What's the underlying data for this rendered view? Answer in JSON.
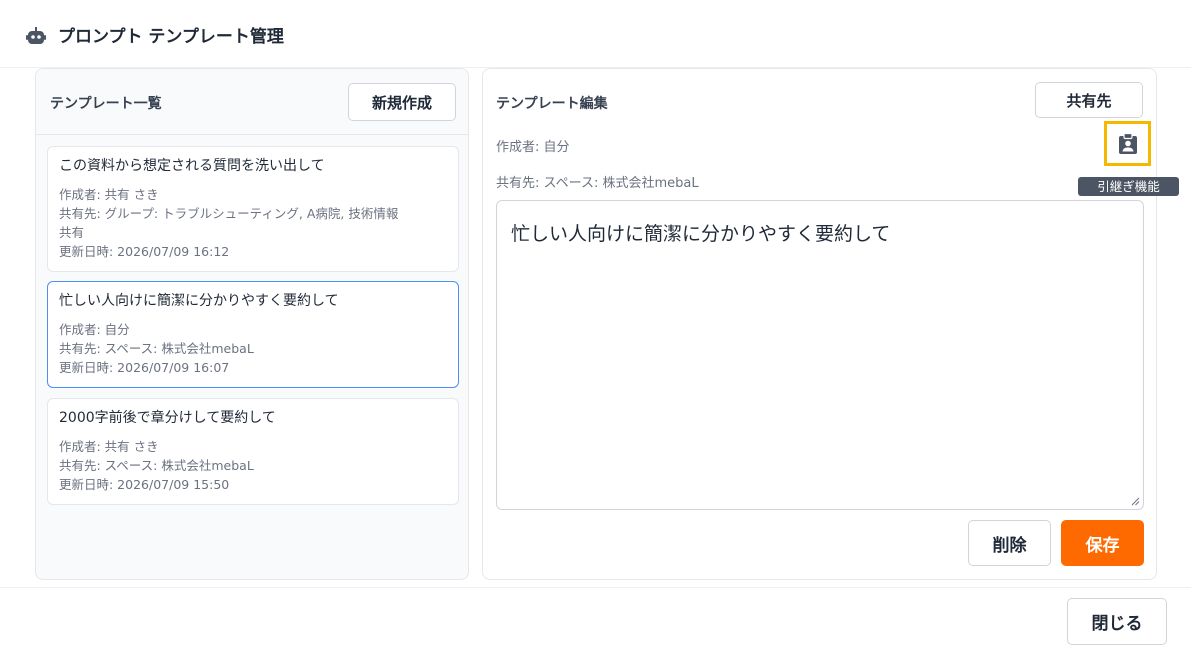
{
  "header": {
    "icon": "robot-icon",
    "title": "プロンプト テンプレート管理"
  },
  "list_panel": {
    "title": "テンプレート一覧",
    "new_button": "新規作成",
    "templates": [
      {
        "title": "この資料から想定される質問を洗い出して",
        "author": "作成者: 共有 さき",
        "share_line1": "共有先: グループ: トラブルシューティング, A病院, 技術情報",
        "share_line2": "共有",
        "updated": "更新日時: 2026/07/09 16:12",
        "selected": false
      },
      {
        "title": "忙しい人向けに簡潔に分かりやすく要約して",
        "author": "作成者: 自分",
        "share_line1": "共有先: スペース: 株式会社mebaL",
        "updated": "更新日時: 2026/07/09 16:07",
        "selected": true
      },
      {
        "title": "2000字前後で章分けして要約して",
        "author": "作成者: 共有 さき",
        "share_line1": "共有先: スペース: 株式会社mebaL",
        "updated": "更新日時: 2026/07/09 15:50",
        "selected": false
      }
    ]
  },
  "edit_panel": {
    "title": "テンプレート編集",
    "share_button": "共有先",
    "author": "作成者: 自分",
    "share_target": "共有先: スペース: 株式会社mebaL",
    "handover_icon": "clipboard-account-icon",
    "handover_tooltip": "引継ぎ機能",
    "content": "忙しい人向けに簡潔に分かりやすく要約して",
    "delete_button": "削除",
    "save_button": "保存"
  },
  "footer": {
    "close_button": "閉じる"
  },
  "colors": {
    "accent": "#ff6a00",
    "selected_border": "#4f8ef7",
    "highlight": "#f5b800"
  }
}
